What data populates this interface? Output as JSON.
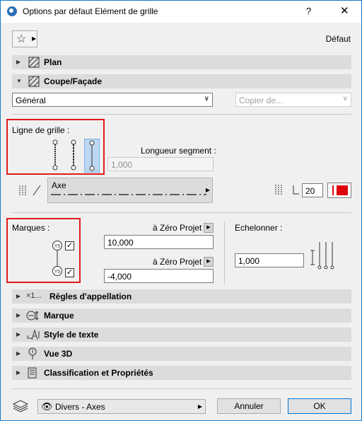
{
  "window": {
    "title": "Options par défaut Elément de grille",
    "help": "?",
    "close": "✕"
  },
  "header": {
    "preset_label": "Défaut"
  },
  "sections_top": [
    {
      "label": "Plan"
    },
    {
      "label": "Coupe/Façade"
    }
  ],
  "coupe": {
    "general_select": "Général",
    "copy_select": "Copier de..."
  },
  "ligne": {
    "title": "Ligne de grille :",
    "segment_label": "Longueur segment :",
    "segment_value": "1,000",
    "linetype": "Axe",
    "pen_value": "20"
  },
  "marques": {
    "title": "Marques :",
    "top_zero_label": "à Zéro Projet",
    "top_value": "10,000",
    "bottom_zero_label": "à Zéro Projet",
    "bottom_value": "-4,000",
    "echelonner_label": "Echelonner :",
    "echelonner_value": "1,000",
    "marker_top": "Y5",
    "marker_bottom": "Y5"
  },
  "sections_bottom": [
    {
      "label": "Règles d'appellation",
      "icon_text": "×1..."
    },
    {
      "label": "Marque"
    },
    {
      "label": "Style de texte"
    },
    {
      "label": "Vue 3D"
    },
    {
      "label": "Classification et Propriétés"
    }
  ],
  "footer": {
    "layer": "Divers - Axes",
    "cancel": "Annuler",
    "ok": "OK"
  },
  "colors": {
    "pen": "#e0000c",
    "highlight": "#e01b1b",
    "accent": "#0078d7"
  }
}
